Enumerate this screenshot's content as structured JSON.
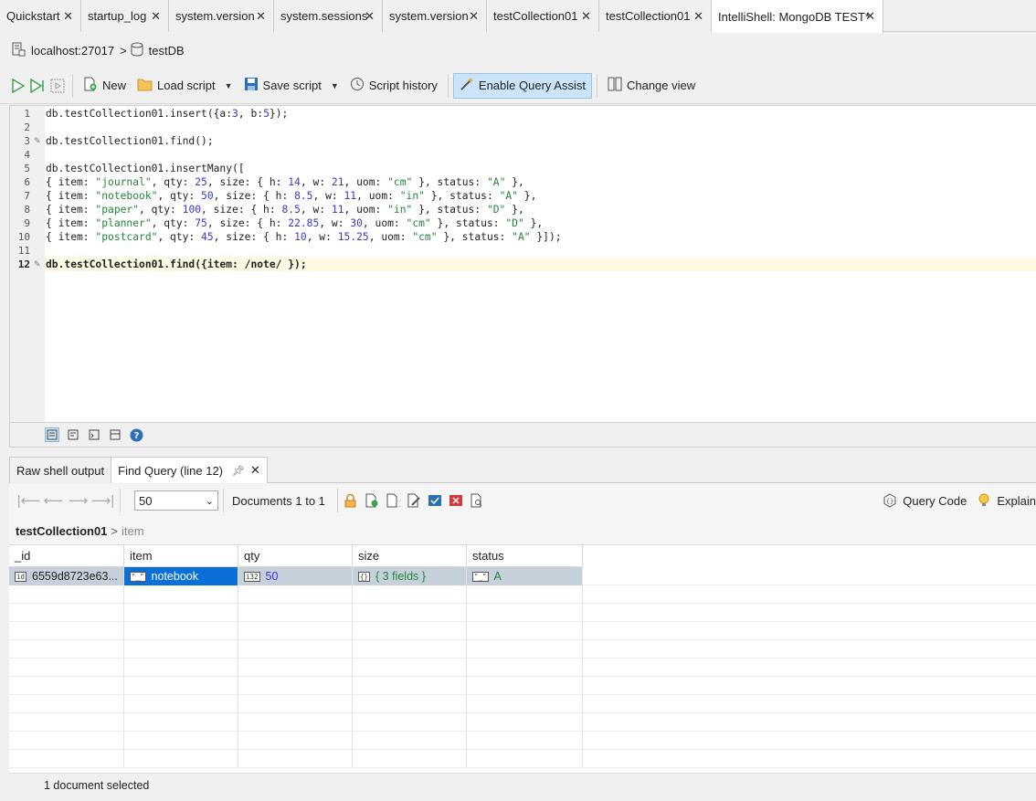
{
  "tabs": [
    {
      "label": "Quickstart",
      "active": false
    },
    {
      "label": "startup_log",
      "active": false
    },
    {
      "label": "system.version",
      "active": false
    },
    {
      "label": "system.sessions",
      "active": false
    },
    {
      "label": "system.version",
      "active": false
    },
    {
      "label": "testCollection01",
      "active": false
    },
    {
      "label": "testCollection01",
      "active": false
    },
    {
      "label": "IntelliShell: MongoDB TEST*",
      "active": true
    }
  ],
  "connection": {
    "host": "localhost:27017",
    "database": "testDB"
  },
  "toolbar": {
    "new_label": "New",
    "load_label": "Load script",
    "save_label": "Save script",
    "history_label": "Script history",
    "query_assist_label": "Enable Query Assist",
    "change_view_label": "Change view"
  },
  "editor": {
    "current_line": 12,
    "lines": [
      {
        "n": "1",
        "text": "db.testCollection01.insert({a:3, b:5});"
      },
      {
        "n": "2",
        "text": ""
      },
      {
        "n": "3",
        "text": "db.testCollection01.find();"
      },
      {
        "n": "4",
        "text": ""
      },
      {
        "n": "5",
        "text": "db.testCollection01.insertMany(["
      },
      {
        "n": "6",
        "text": "{ item: \"journal\", qty: 25, size: { h: 14, w: 21, uom: \"cm\" }, status: \"A\" },"
      },
      {
        "n": "7",
        "text": "{ item: \"notebook\", qty: 50, size: { h: 8.5, w: 11, uom: \"in\" }, status: \"A\" },"
      },
      {
        "n": "8",
        "text": "{ item: \"paper\", qty: 100, size: { h: 8.5, w: 11, uom: \"in\" }, status: \"D\" },"
      },
      {
        "n": "9",
        "text": "{ item: \"planner\", qty: 75, size: { h: 22.85, w: 30, uom: \"cm\" }, status: \"D\" },"
      },
      {
        "n": "10",
        "text": "{ item: \"postcard\", qty: 45, size: { h: 10, w: 15.25, uom: \"cm\" }, status: \"A\" }]);"
      },
      {
        "n": "11",
        "text": ""
      },
      {
        "n": "12",
        "text": "db.testCollection01.find({item: /note/ });"
      }
    ]
  },
  "result_tabs": {
    "raw_label": "Raw shell output",
    "find_label": "Find Query (line 12)"
  },
  "results_toolbar": {
    "page_size": "50",
    "documents_label": "Documents 1 to 1",
    "query_code_label": "Query Code",
    "explain_label": "Explain"
  },
  "breadcrumb": {
    "collection": "testCollection01",
    "field": "item"
  },
  "grid": {
    "columns": [
      "_id",
      "item",
      "qty",
      "size",
      "status"
    ],
    "rows": [
      {
        "_id": "6559d8723e63...",
        "item": "notebook",
        "qty": "50",
        "size": "{ 3 fields }",
        "status": "A"
      }
    ]
  },
  "status": {
    "text": "1 document selected"
  },
  "colors": {
    "accent": "#0a6fd8",
    "string": "#22863a",
    "number": "#3a3ad4",
    "play": "#3fa34d"
  }
}
